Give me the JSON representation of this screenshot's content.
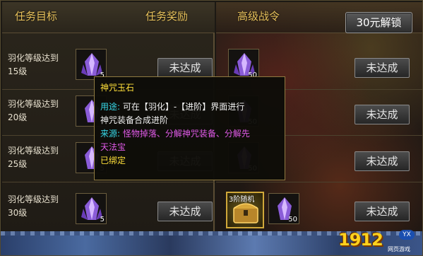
{
  "header": {
    "task_goal": "任务目标",
    "task_reward": "任务奖励",
    "advanced_battle_order": "高级战令",
    "unlock_button": "30元解锁"
  },
  "rows": [
    {
      "task_line1": "羽化等级达到",
      "task_line2": "15级",
      "left_count": "5",
      "right_count": "50",
      "status": "未达成"
    },
    {
      "task_line1": "羽化等级达到",
      "task_line2": "20级",
      "left_count": "5",
      "right_count": "50",
      "status": "未达成"
    },
    {
      "task_line1": "羽化等级达到",
      "task_line2": "25级",
      "left_count": "5",
      "right_count": "50",
      "status": "未达成"
    },
    {
      "task_line1": "羽化等级达到",
      "task_line2": "30级",
      "left_count": "5",
      "right_count": "50",
      "status": "未达成",
      "chest_label": "3阶随机"
    }
  ],
  "tooltip": {
    "title": "神咒玉石",
    "usage_label": "用途:",
    "usage_text_1": "可在【羽化】-【进阶】界面进行",
    "usage_text_2": "神咒装备合成进阶",
    "source_label": "来源:",
    "source_text_1": "怪物掉落、分解神咒装备、分解先",
    "source_text_2": "天法宝",
    "bound_text": "已绑定"
  },
  "logo": {
    "number": "1912",
    "badge": "YX",
    "subtitle": "网页游戏"
  },
  "colors": {
    "accent_gold": "#e8c25c",
    "tooltip_title": "#ffe03a",
    "tooltip_cyan": "#37d8e8",
    "tooltip_magenta": "#e05ae8"
  },
  "icons": {
    "item_gem": "purple-crystal-gem-icon",
    "chest": "golden-chest-icon"
  }
}
